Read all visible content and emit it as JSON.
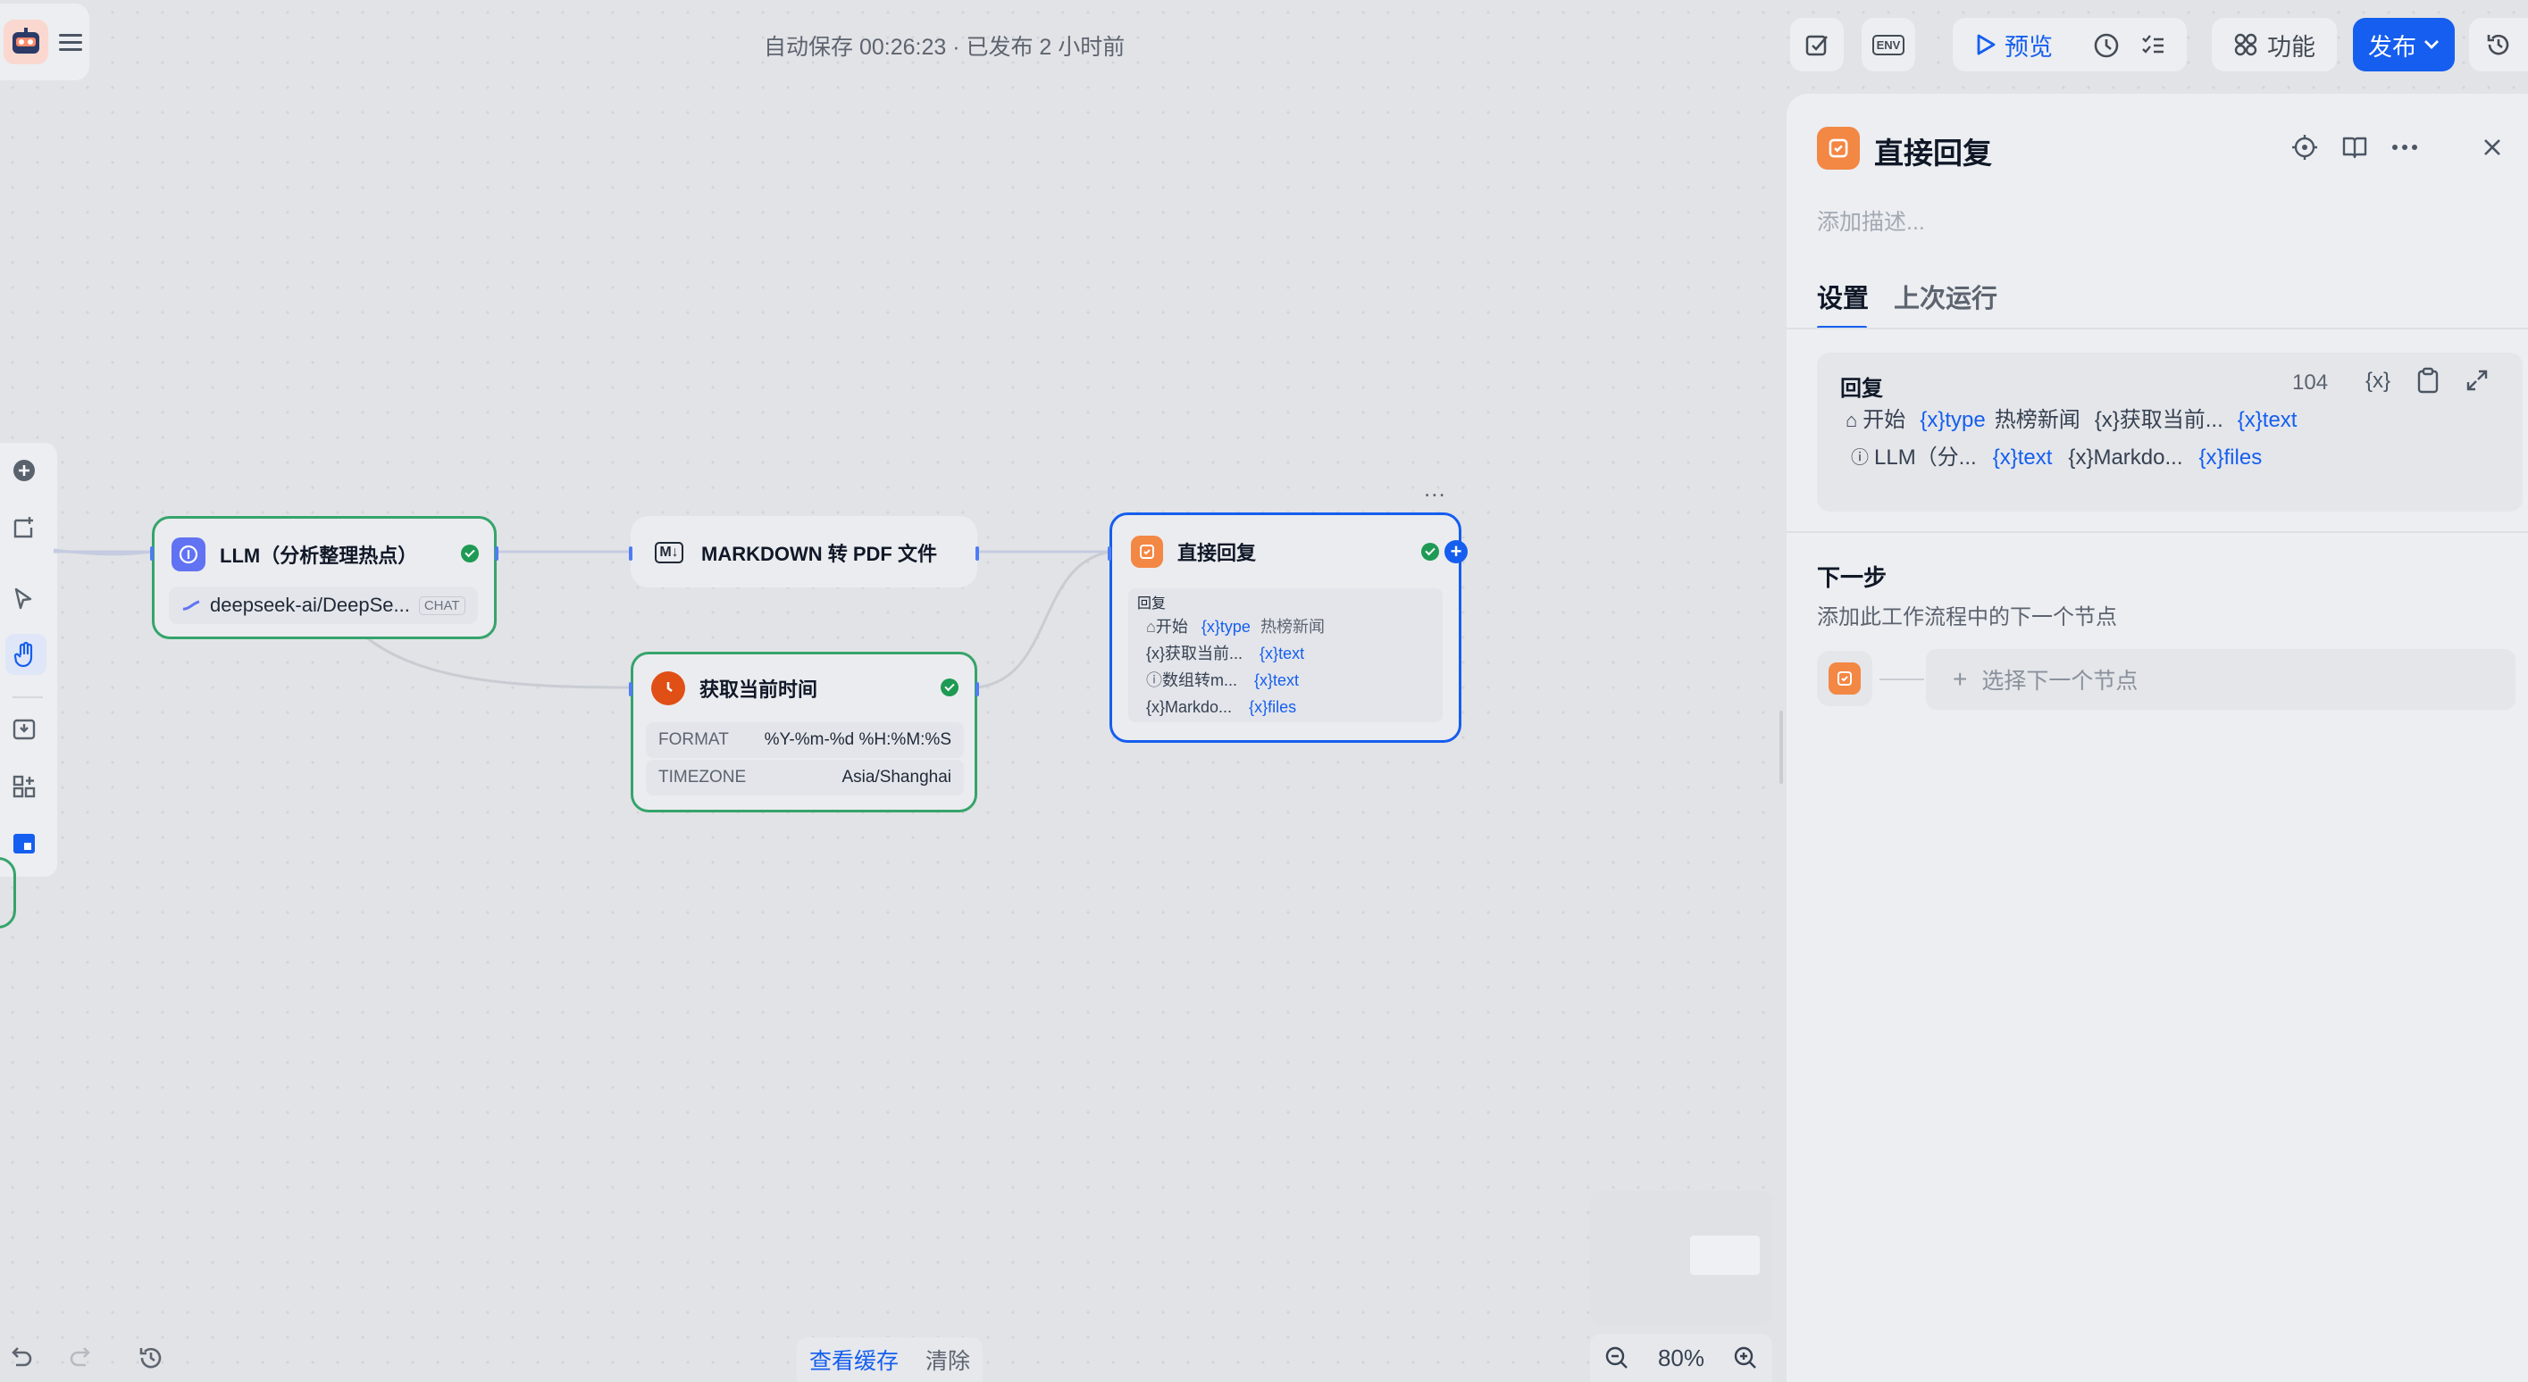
{
  "header": {
    "autosave": "自动保存 00:26:23 · 已发布 2 小时前",
    "env_label": "ENV",
    "preview_label": "预览",
    "features_label": "功能",
    "publish_label": "发布"
  },
  "nodes": {
    "llm": {
      "title": "LLM（分析整理热点）",
      "model": "deepseek-ai/DeepSe...",
      "model_badge": "CHAT"
    },
    "md2pdf": {
      "title": "MARKDOWN 转 PDF 文件",
      "icon_text": "M↓"
    },
    "time": {
      "title": "获取当前时间",
      "rows": [
        {
          "key": "FORMAT",
          "value": "%Y-%m-%d %H:%M:%S"
        },
        {
          "key": "TIMEZONE",
          "value": "Asia/Shanghai"
        }
      ]
    },
    "reply": {
      "title": "直接回复",
      "section_label": "回复",
      "more": "...",
      "rows": [
        {
          "prefix": "开始",
          "var": "{x}type",
          "extra": "热榜新闻"
        },
        {
          "prefix": "{x}获取当前...",
          "var": "{x}text",
          "extra": ""
        },
        {
          "prefix": "数组转m...",
          "var": "{x}text",
          "extra": ""
        },
        {
          "prefix": "{x}Markdo...",
          "var": "{x}files",
          "extra": ""
        }
      ]
    }
  },
  "bottom": {
    "view_cache": "查看缓存",
    "clear": "清除",
    "zoom": "80%"
  },
  "panel": {
    "title": "直接回复",
    "description_placeholder": "添加描述...",
    "tabs": [
      "设置",
      "上次运行"
    ],
    "reply_label": "回复",
    "char_count": "104",
    "var_button": "{x}",
    "line1": {
      "start": "开始",
      "var_type": "{x}type",
      "text1": "热榜新闻",
      "get_time": "{x}获取当前...",
      "var_text": "{x}text"
    },
    "line2": {
      "llm": "LLM（分...",
      "var_text": "{x}text",
      "markdown": "{x}Markdo...",
      "var_files": "{x}files"
    },
    "next_title": "下一步",
    "next_desc": "添加此工作流程中的下一个节点",
    "select_next": "选择下一个节点"
  },
  "colors": {
    "accent": "#155eef",
    "llm_icon": "#6172f3",
    "reply_icon": "#f38744",
    "time_icon": "#e04f16",
    "success": "#1e9a54"
  }
}
